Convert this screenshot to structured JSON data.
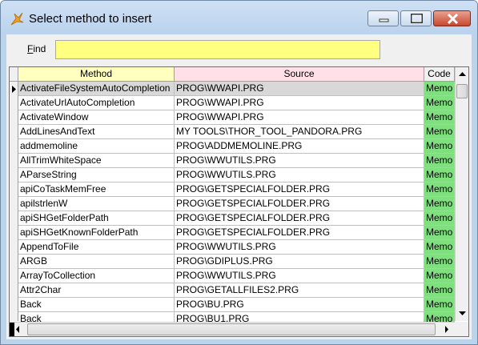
{
  "window": {
    "title": "Select method to insert"
  },
  "find": {
    "label_prefix": "F",
    "label_rest": "ind",
    "value": ""
  },
  "grid": {
    "columns": [
      "Method",
      "Source",
      "Code"
    ],
    "header_colors": {
      "method": "#ffffc0",
      "source": "#ffe0e8",
      "code": "#f0f0f0"
    },
    "code_color": "#80e080",
    "rows": [
      {
        "method": "ActivateFileSystemAutoCompletion",
        "source": "PROG\\WWAPI.PRG",
        "code": "Memo"
      },
      {
        "method": "ActivateUrlAutoCompletion",
        "source": "PROG\\WWAPI.PRG",
        "code": "Memo"
      },
      {
        "method": "ActivateWindow",
        "source": "PROG\\WWAPI.PRG",
        "code": "Memo"
      },
      {
        "method": "AddLinesAndText",
        "source": "MY TOOLS\\THOR_TOOL_PANDORA.PRG",
        "code": "Memo"
      },
      {
        "method": "addmemoline",
        "source": "PROG\\ADDMEMOLINE.PRG",
        "code": "Memo"
      },
      {
        "method": "AllTrimWhiteSpace",
        "source": "PROG\\WWUTILS.PRG",
        "code": "Memo"
      },
      {
        "method": "AParseString",
        "source": "PROG\\WWUTILS.PRG",
        "code": "Memo"
      },
      {
        "method": "apiCoTaskMemFree",
        "source": "PROG\\GETSPECIALFOLDER.PRG",
        "code": "Memo"
      },
      {
        "method": "apilstrlenW",
        "source": "PROG\\GETSPECIALFOLDER.PRG",
        "code": "Memo"
      },
      {
        "method": "apiSHGetFolderPath",
        "source": "PROG\\GETSPECIALFOLDER.PRG",
        "code": "Memo"
      },
      {
        "method": "apiSHGetKnownFolderPath",
        "source": "PROG\\GETSPECIALFOLDER.PRG",
        "code": "Memo"
      },
      {
        "method": "AppendToFile",
        "source": "PROG\\WWUTILS.PRG",
        "code": "Memo"
      },
      {
        "method": "ARGB",
        "source": "PROG\\GDIPLUS.PRG",
        "code": "Memo"
      },
      {
        "method": "ArrayToCollection",
        "source": "PROG\\WWUTILS.PRG",
        "code": "Memo"
      },
      {
        "method": "Attr2Char",
        "source": "PROG\\GETALLFILES2.PRG",
        "code": "Memo"
      },
      {
        "method": "Back",
        "source": "PROG\\BU.PRG",
        "code": "Memo"
      },
      {
        "method": "Back",
        "source": "PROG\\BU1.PRG",
        "code": "Memo"
      }
    ]
  }
}
